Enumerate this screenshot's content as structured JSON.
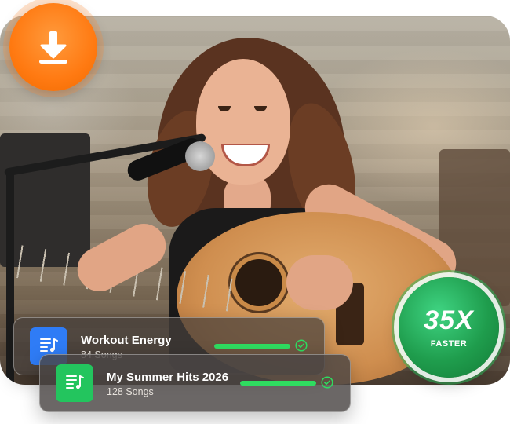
{
  "speed_badge": {
    "value": "35X",
    "label": "FASTER",
    "color": "#23a856"
  },
  "download_badge": {
    "icon": "download-icon",
    "color": "#ff7a12"
  },
  "playlists": [
    {
      "title": "Workout Energy",
      "count": "84 Songs",
      "icon": "music-list-icon",
      "cover_color": "#2f7cf6",
      "progress": 1.0,
      "status": "complete"
    },
    {
      "title": "My Summer Hits 2026",
      "count": "128 Songs",
      "icon": "music-list-icon",
      "cover_color": "#23c55e",
      "progress": 1.0,
      "status": "complete"
    }
  ],
  "accent_color": "#2fdc60"
}
